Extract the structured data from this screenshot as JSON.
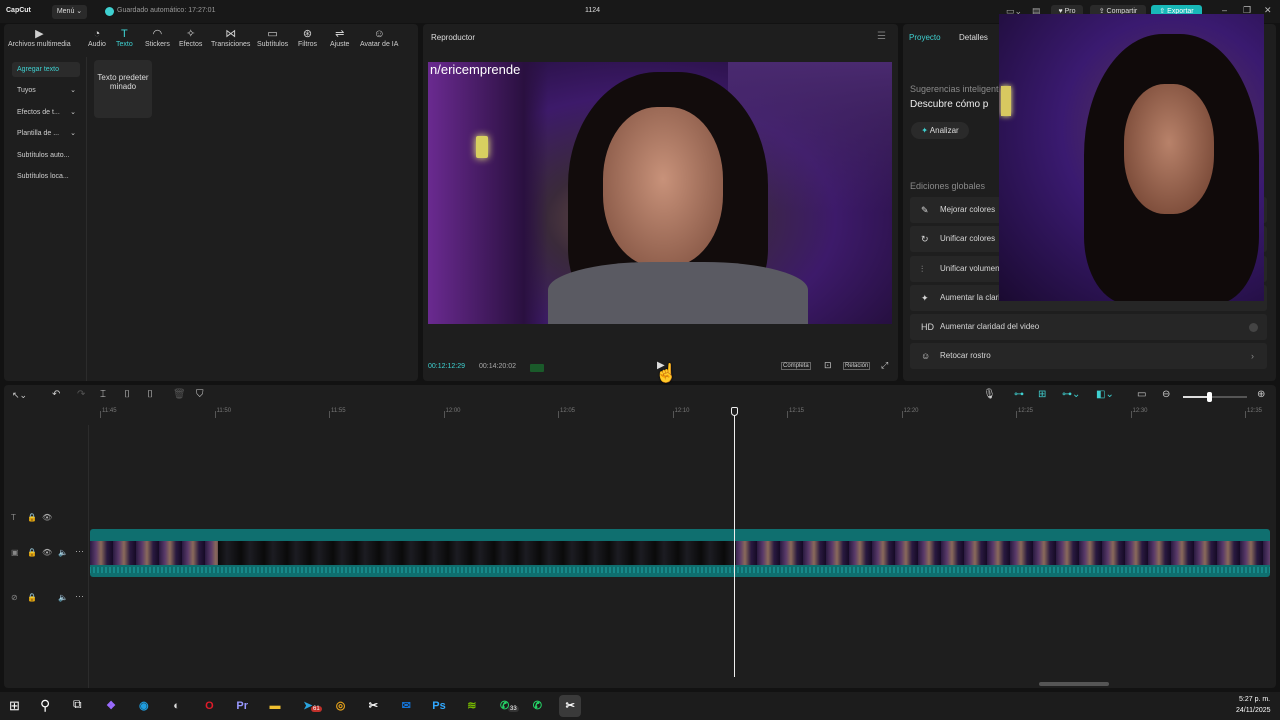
{
  "topbar": {
    "logo": "CapCut",
    "menu": "Menú",
    "autosave": "Guardado automático: 17:27:01",
    "project_name": "1124",
    "pro": "Pro",
    "share": "Compartir",
    "export": "Exportar"
  },
  "toolbar": [
    {
      "label": "Archivos multimedia",
      "icon": "▶",
      "name": "media"
    },
    {
      "label": "Audio",
      "icon": "◔",
      "name": "audio"
    },
    {
      "label": "Texto",
      "icon": "T",
      "name": "text"
    },
    {
      "label": "Stickers",
      "icon": "◠",
      "name": "stickers"
    },
    {
      "label": "Efectos",
      "icon": "✧",
      "name": "effects"
    },
    {
      "label": "Transiciones",
      "icon": "⋈",
      "name": "transitions"
    },
    {
      "label": "Subtítulos",
      "icon": "▭",
      "name": "subtitles"
    },
    {
      "label": "Filtros",
      "icon": "⊛",
      "name": "filters"
    },
    {
      "label": "Ajuste",
      "icon": "⇌",
      "name": "adjust"
    },
    {
      "label": "Avatar de IA",
      "icon": "☺",
      "name": "ai-avatar"
    }
  ],
  "sidebar": {
    "items": [
      {
        "label": "Agregar texto"
      },
      {
        "label": "Tuyos"
      },
      {
        "label": "Efectos de t..."
      },
      {
        "label": "Plantilla de ..."
      },
      {
        "label": "Subtítulos auto..."
      },
      {
        "label": "Subtítulos loca..."
      }
    ],
    "default_text_card": "Texto predeterminado"
  },
  "player": {
    "title": "Reproductor",
    "overlay_text": "n/ericemprende",
    "current_time": "00:12:12:29",
    "total_time": "00:14:20:02",
    "full": "Completa",
    "ratio": "Relación"
  },
  "right": {
    "tab_project": "Proyecto",
    "tab_details": "Detalles",
    "suggestions_label": "Sugerencias inteligentes",
    "suggestions_text": "Descubre cómo p",
    "analyze": "Analizar",
    "global_edits": "Ediciones globales",
    "edits": [
      {
        "label": "Mejorar colores",
        "icon": "✎"
      },
      {
        "label": "Unificar colores",
        "icon": "↻"
      },
      {
        "label": "Unificar volumen",
        "icon": "⫶"
      },
      {
        "label": "Aumentar la claridad de la voz",
        "icon": "✦"
      },
      {
        "label": "Aumentar claridad del video",
        "icon": "HD"
      },
      {
        "label": "Retocar rostro",
        "icon": "☺"
      }
    ]
  },
  "timeline": {
    "ticks": [
      "11:45",
      "11:50",
      "11:55",
      "12:00",
      "12:05",
      "12:10",
      "12:15",
      "12:20",
      "12:25",
      "12:30",
      "12:35"
    ]
  },
  "taskbar": {
    "time": "5:27 p. m.",
    "date": "24/11/2025",
    "whatsapp_badge": "33",
    "telegram_badge": "61",
    "apps": [
      {
        "name": "copilot",
        "glyph": "❖",
        "color": "#9b6bff"
      },
      {
        "name": "edge",
        "glyph": "◉",
        "color": "#1f9ee0"
      },
      {
        "name": "obs",
        "glyph": "◐",
        "color": "#dddddd"
      },
      {
        "name": "opera",
        "glyph": "O",
        "color": "#e01b2a"
      },
      {
        "name": "premiere",
        "glyph": "Pr",
        "color": "#9999ff"
      },
      {
        "name": "explorer",
        "glyph": "▬",
        "color": "#f0c030"
      },
      {
        "name": "telegram",
        "glyph": "➤",
        "color": "#2aa3de"
      },
      {
        "name": "chrome",
        "glyph": "◎",
        "color": "#e4a11b"
      },
      {
        "name": "capcut",
        "glyph": "✂",
        "color": "#ffffff"
      },
      {
        "name": "outlook",
        "glyph": "✉",
        "color": "#1473d6"
      },
      {
        "name": "photoshop",
        "glyph": "Ps",
        "color": "#31a8ff"
      },
      {
        "name": "nvidia",
        "glyph": "≋",
        "color": "#76b900"
      },
      {
        "name": "whatsapp",
        "glyph": "✆",
        "color": "#25d366"
      },
      {
        "name": "whatsapp-business",
        "glyph": "✆",
        "color": "#25d366"
      },
      {
        "name": "capcut-active",
        "glyph": "✂",
        "color": "#ffffff"
      }
    ]
  }
}
